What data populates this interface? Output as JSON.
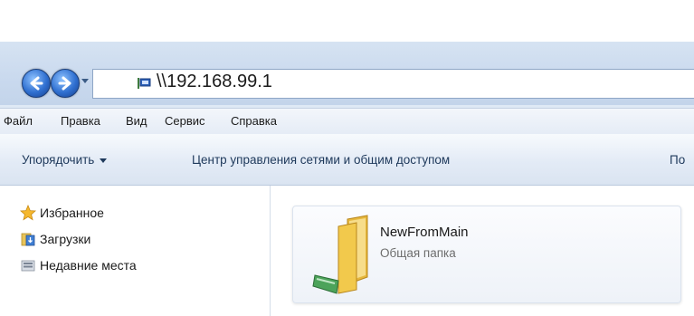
{
  "address_bar": {
    "path": "\\\\192.168.99.1"
  },
  "menu": {
    "items": [
      "Файл",
      "Правка",
      "Вид",
      "Сервис",
      "Справка"
    ]
  },
  "command_bar": {
    "organize": "Упорядочить",
    "network_center": "Центр управления сетями и общим доступом",
    "cut_item": "По"
  },
  "nav_pane": {
    "items": [
      {
        "label": "Избранное",
        "icon": "star-icon"
      },
      {
        "label": "Загрузки",
        "icon": "downloads-folder-icon"
      },
      {
        "label": "Недавние места",
        "icon": "recent-places-icon"
      }
    ]
  },
  "content": {
    "items": [
      {
        "name": "NewFromMain",
        "type": "Общая папка",
        "icon": "shared-folder-icon"
      }
    ]
  },
  "colors": {
    "window_bg": "#dfe9f5",
    "nav_button_blue": "#2f6fd0",
    "folder_yellow": "#f2c94c",
    "text_secondary": "#6d6d6d"
  }
}
